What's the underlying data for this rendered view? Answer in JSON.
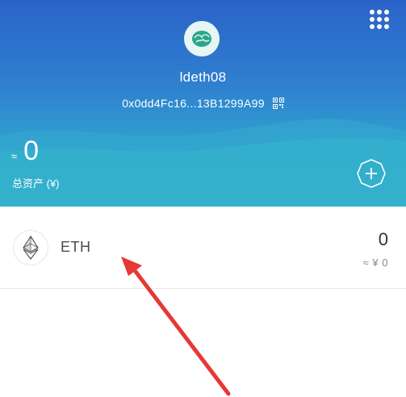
{
  "wallet": {
    "name": "ldeth08",
    "address": "0x0dd4Fc16...13B1299A99"
  },
  "summary": {
    "approx_symbol": "≈",
    "balance": "0",
    "label": "总资产 (¥)"
  },
  "tokens": [
    {
      "symbol": "ETH",
      "amount": "0",
      "value": "≈ ¥ 0",
      "icon": "ethereum-icon"
    }
  ],
  "icons": {
    "menu": "grid-menu-icon",
    "avatar": "wallet-avatar-icon",
    "qr": "qr-code-icon",
    "add": "add-token-icon"
  },
  "colors": {
    "header_top": "#2b63c8",
    "header_bottom": "#2fb2c9",
    "annotation_arrow": "#e53935"
  }
}
